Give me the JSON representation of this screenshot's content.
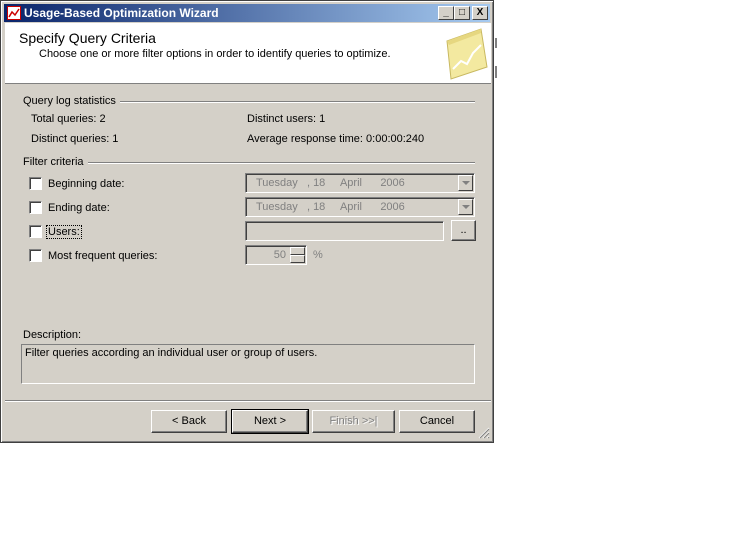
{
  "window": {
    "title": "Usage-Based Optimization Wizard"
  },
  "titlebar_buttons": {
    "minimize": "_",
    "maximize": "□",
    "close": "X"
  },
  "header": {
    "title": "Specify Query Criteria",
    "subtitle": "Choose one or more filter options in order to identify queries to optimize."
  },
  "stats": {
    "group_label": "Query log statistics",
    "total_queries": "Total queries: 2",
    "distinct_users": "Distinct users: 1",
    "distinct_queries": "Distinct queries: 1",
    "avg_response": "Average response time: 0:00:00:240"
  },
  "filter": {
    "group_label": "Filter criteria",
    "beginning_label": "Beginning date:",
    "beginning_value": "Tuesday   , 18     April      2006",
    "ending_label": "Ending date:",
    "ending_value": "Tuesday   , 18     April      2006",
    "users_label": "Users:",
    "users_browse": "..",
    "frequent_label": "Most frequent queries:",
    "frequent_value": "50",
    "frequent_unit": "%"
  },
  "description": {
    "label": "Description:",
    "text": "Filter queries according an individual user or group of users."
  },
  "buttons": {
    "back": "< Back",
    "next": "Next >",
    "finish": "Finish >>|",
    "cancel": "Cancel"
  },
  "icons": [
    "app-icon",
    "wizard-chart-icon",
    "resize-grip-icon"
  ]
}
